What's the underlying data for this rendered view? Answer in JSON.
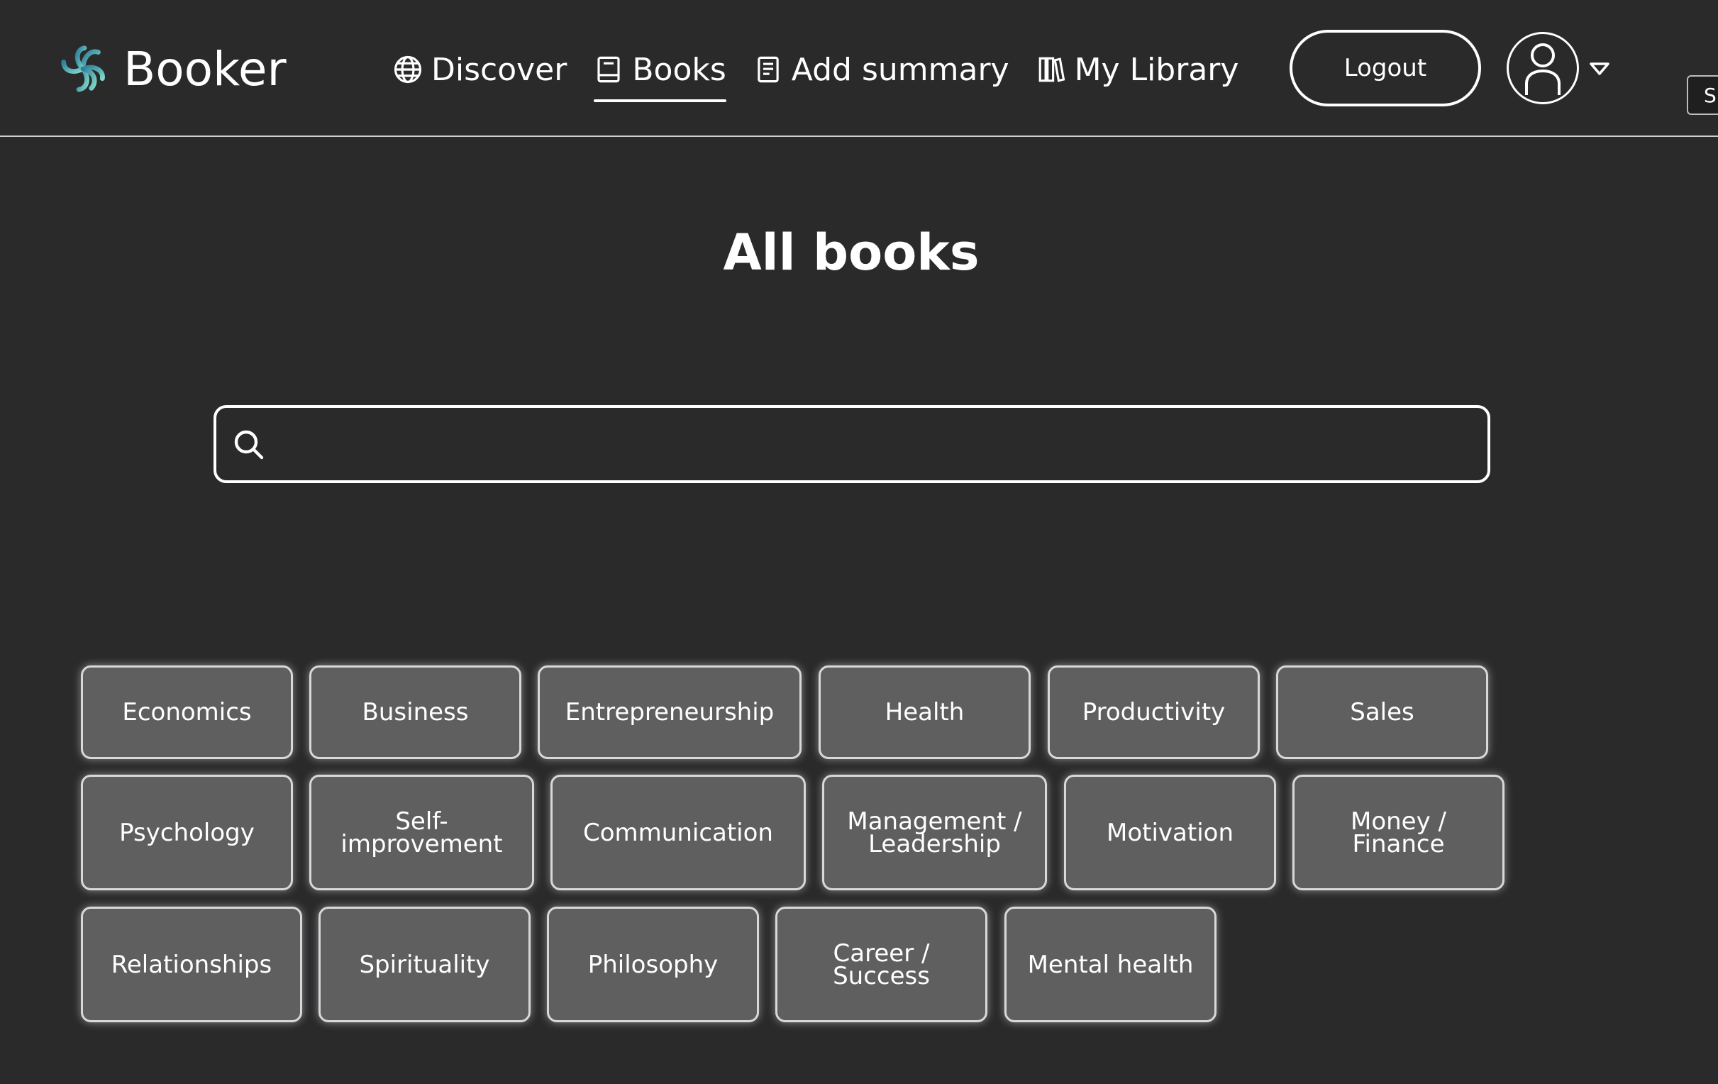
{
  "brand": {
    "name": "Booker"
  },
  "nav": {
    "items": [
      {
        "label": "Discover",
        "icon": "globe-icon"
      },
      {
        "label": "Books",
        "icon": "book-icon",
        "active": true
      },
      {
        "label": "Add summary",
        "icon": "document-icon"
      },
      {
        "label": "My Library",
        "icon": "library-icon"
      }
    ]
  },
  "header": {
    "logout_label": "Logout",
    "edge_tab_label": "S"
  },
  "main": {
    "title": "All books",
    "search": {
      "value": "",
      "placeholder": ""
    },
    "categories": [
      "Economics",
      "Business",
      "Entrepreneurship",
      "Health",
      "Productivity",
      "Sales",
      "Psychology",
      "Self-improvement",
      "Communication",
      "Management / Leadership",
      "Motivation",
      "Money / Finance",
      "Relationships",
      "Spirituality",
      "Philosophy",
      "Career / Success",
      "Mental health"
    ]
  },
  "colors": {
    "background": "#2a2a2b",
    "chip": "#5f5f5f",
    "chip_border": "#d8d8d8",
    "text": "#ffffff"
  }
}
